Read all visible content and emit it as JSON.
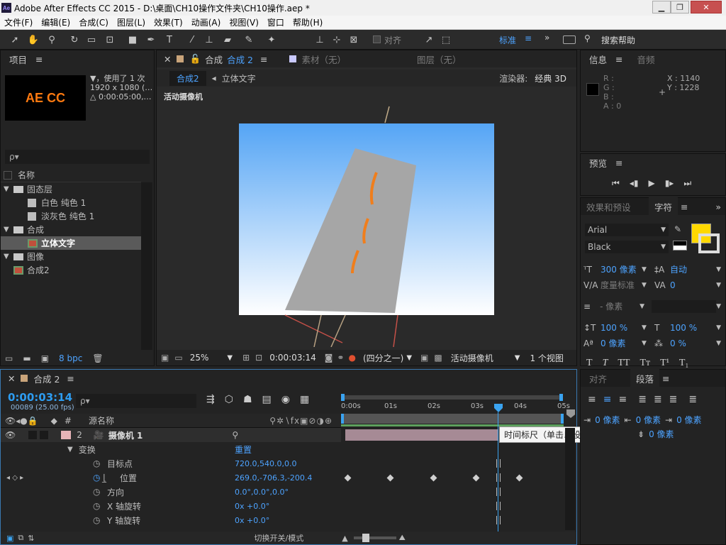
{
  "window": {
    "title": "Adobe After Effects CC 2015 - D:\\桌面\\CH10操作文件夹\\CH10操作.aep *",
    "logo": "Ae"
  },
  "menu": [
    "文件(F)",
    "编辑(E)",
    "合成(C)",
    "图层(L)",
    "效果(T)",
    "动画(A)",
    "视图(V)",
    "窗口",
    "帮助(H)"
  ],
  "toolbar": {
    "align_label": "对齐",
    "workspace": "标准",
    "search_help": "搜索帮助"
  },
  "project": {
    "title": "项目",
    "thumb_text": "AE CC",
    "info_line1": "▼，使用了 1 次",
    "info_line2": "1920 x 1080 (…",
    "info_line3": "△ 0:00:05:00,…",
    "search_placeholder": "ρ▾",
    "col_name": "名称",
    "items": [
      {
        "label": "固态层",
        "type": "folder",
        "level": 0
      },
      {
        "label": "白色 纯色 1",
        "type": "solid",
        "level": 1
      },
      {
        "label": "淡灰色 纯色 1",
        "type": "solid",
        "level": 1
      },
      {
        "label": "合成",
        "type": "folder",
        "level": 0
      },
      {
        "label": "立体文字",
        "type": "comp",
        "level": 1,
        "selected": true
      },
      {
        "label": "图像",
        "type": "folder",
        "level": 0
      },
      {
        "label": "合成2",
        "type": "comp",
        "level": 0
      }
    ],
    "bpc": "8 bpc"
  },
  "composition": {
    "tab_label": "合成",
    "tab_comp": "合成 2",
    "tab_footage": "素材（无）",
    "tab_layer": "图层（无）",
    "breadcrumb_active": "合成2",
    "breadcrumb_next": "立体文字",
    "renderer_label": "渲染器:",
    "renderer_value": "经典 3D",
    "camera_label": "活动摄像机",
    "zoom": "25%",
    "timecode": "0:00:03:14",
    "resolution": "(四分之一)",
    "view_camera": "活动摄像机",
    "views": "1 个视图"
  },
  "info": {
    "tab": "信息",
    "tab2": "音频",
    "r": "R :",
    "g": "G :",
    "b": "B :",
    "a": "A : 0",
    "x": "X : 1140",
    "y": "Y : 1228"
  },
  "preview": {
    "title": "预览"
  },
  "character": {
    "tab1": "效果和预设",
    "tab2": "字符",
    "font": "Arial",
    "style": "Black",
    "size": "300 像素",
    "leading": "自动",
    "kerning": "度量标准",
    "tracking": "0",
    "stroke": "- 像素",
    "vscale": "100 %",
    "hscale": "100 %",
    "baseline": "0 像素",
    "tsume": "0 %",
    "fill_color": "#ffd800"
  },
  "paragraph": {
    "tab1": "对齐",
    "tab2": "段落",
    "indent1": "0 像素",
    "indent2": "0 像素",
    "indent3": "0 像素",
    "space": "0 像素"
  },
  "timeline": {
    "tab": "合成 2",
    "time": "0:00:03:14",
    "frames": "00089 (25.00 fps)",
    "col_num": "#",
    "col_src": "源名称",
    "ruler": [
      "0:00s",
      "01s",
      "02s",
      "03s",
      "04s",
      "05s"
    ],
    "layer": {
      "num": "2",
      "name": "摄像机 1"
    },
    "transform": "变换",
    "reset": "重置",
    "props": [
      {
        "name": "目标点",
        "value": "720.0,540.0,0.0"
      },
      {
        "name": "位置",
        "value": "269.0,-706.3,-200.4"
      },
      {
        "name": "方向",
        "value": "0.0°,0.0°,0.0°"
      },
      {
        "name": "X 轴旋转",
        "value": "0x +0.0°"
      },
      {
        "name": "Y 轴旋转",
        "value": "0x +0.0°"
      }
    ],
    "tooltip": "时间标尺（单击以设置缩览图）",
    "toggle_label": "切换开关/模式",
    "current_time_fraction": 0.7
  }
}
